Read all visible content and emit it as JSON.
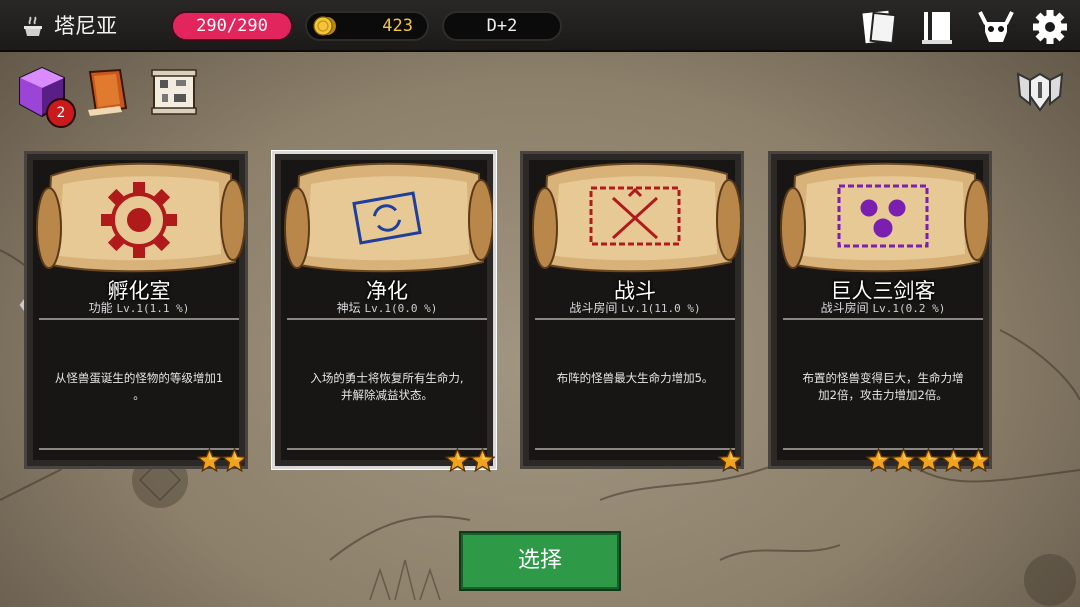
{
  "topbar": {
    "location_name": "塔尼亚",
    "hp": "290/290",
    "gold": "423",
    "day": "D+2",
    "icons": [
      "pot-icon",
      "coin-icon",
      "cards-icon",
      "book-icon",
      "monster-skull-icon",
      "gear-icon"
    ]
  },
  "tools": {
    "badge_count": "2",
    "icons": [
      "purple-cube-icon",
      "spellbook-icon",
      "map-scroll-icon",
      "winged-shield-icon"
    ]
  },
  "cards": [
    {
      "title": "孵化室",
      "category": "功能",
      "level": "Lv.1(1.1 %)",
      "desc_lines": [
        "从怪兽蛋诞生的怪物的等级增加1",
        "。"
      ],
      "stars": 2,
      "emblem": "gear-emblem-icon",
      "emblem_color": "#b01a1a"
    },
    {
      "title": "净化",
      "category": "神坛",
      "level": "Lv.1(0.0 %)",
      "desc_lines": [
        "入场的勇士将恢复所有生命力,",
        "并解除减益状态。"
      ],
      "stars": 2,
      "emblem": "cycle-emblem-icon",
      "emblem_color": "#1f3f9a"
    },
    {
      "title": "战斗",
      "category": "战斗房间",
      "level": "Lv.1(11.0 %)",
      "desc_lines": [
        "布阵的怪兽最大生命力增加5。"
      ],
      "stars": 1,
      "emblem": "crossed-swords-emblem-icon",
      "emblem_color": "#b01a1a"
    },
    {
      "title": "巨人三剑客",
      "category": "战斗房间",
      "level": "Lv.1(0.2 %)",
      "desc_lines": [
        "布置的怪兽变得巨大，生命力增",
        "加2倍，攻击力增加2倍。"
      ],
      "stars": 5,
      "emblem": "three-giants-emblem-icon",
      "emblem_color": "#7a1fb0"
    }
  ],
  "selected_card_index": 1,
  "select_button_label": "选择",
  "colors": {
    "hp": "#e2255d",
    "gold": "#f4c43a",
    "select_button": "#2e9a48"
  }
}
